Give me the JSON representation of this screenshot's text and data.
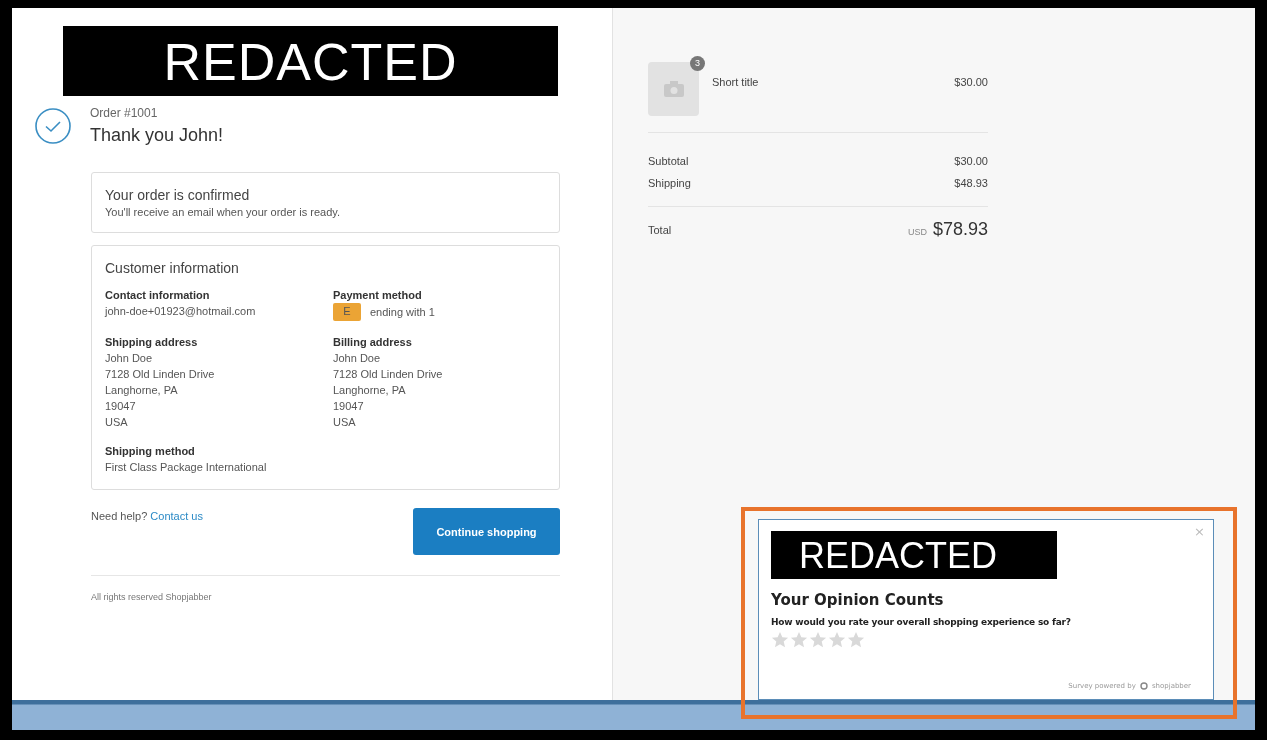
{
  "header": {
    "redaction": "REDACTED"
  },
  "order": {
    "number": "Order #1001",
    "greeting": "Thank you John!"
  },
  "confirmation": {
    "title": "Your order is confirmed",
    "message": "You'll receive an email when your order is ready."
  },
  "customer_information": {
    "title": "Customer information",
    "contact": {
      "label": "Contact information",
      "lines": [
        "john-doe+01923@hotmail.com"
      ]
    },
    "payment": {
      "label": "Payment method",
      "card_badge": "E",
      "text": "ending with 1"
    },
    "shipping_address": {
      "label": "Shipping address",
      "lines": [
        "John Doe",
        "7128 Old Linden Drive",
        "Langhorne, PA",
        "19047",
        "USA"
      ]
    },
    "billing_address": {
      "label": "Billing address",
      "lines": [
        "John Doe",
        "7128 Old Linden Drive",
        "Langhorne, PA",
        "19047",
        "USA"
      ]
    },
    "shipping_method": {
      "label": "Shipping method",
      "lines": [
        "First Class Package International"
      ]
    }
  },
  "help": {
    "text": "Need help?",
    "link": "Contact us"
  },
  "continue_button": "Continue shopping",
  "footer": "All rights reserved Shopjabber",
  "summary": {
    "items": [
      {
        "title": "Short title",
        "quantity": "3",
        "price": "$30.00"
      }
    ],
    "lines": [
      {
        "label": "Subtotal",
        "value": "$30.00"
      },
      {
        "label": "Shipping",
        "value": "$48.93"
      }
    ],
    "total": {
      "label": "Total",
      "currency": "USD",
      "value": "$78.93"
    }
  },
  "survey": {
    "redaction": "REDACTED",
    "close": "×",
    "title": "Your Opinion Counts",
    "question": "How would you rate your overall shopping experience so far?",
    "stars": 0,
    "powered_by": "Survey powered by",
    "brand": "shopjabber",
    "highlighted": true
  }
}
